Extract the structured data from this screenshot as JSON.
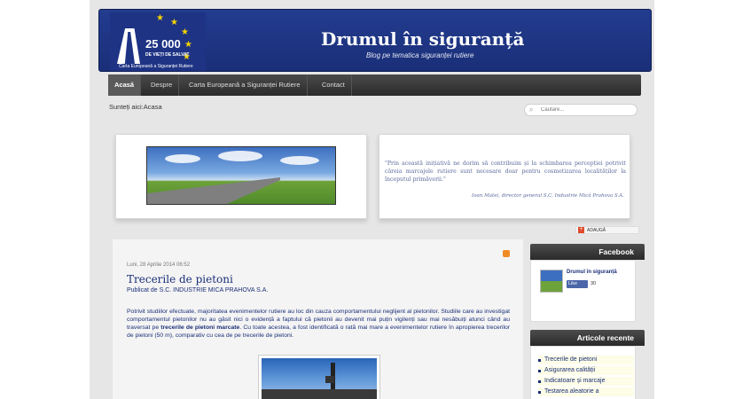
{
  "header": {
    "logo": {
      "number": "25 000",
      "line1": "DE VIEȚI DE SALVAT",
      "line2": "Carta Europeană a Siguranței Rutiere"
    },
    "title": "Drumul în siguranță",
    "tagline": "Blog pe tematica siguranței rutiere"
  },
  "nav": {
    "items": [
      "Acasă",
      "Despre",
      "Carta Europeană a Siguranței Rutiere",
      "Contact"
    ],
    "active_index": 0
  },
  "breadcrumb": "Sunteți aici:Acasa",
  "search": {
    "placeholder": "Căutare..."
  },
  "quote": {
    "text": "\"Prin această inițiativă ne dorim să contribuim și la schimbarea percepției potrivit căreia marcajele rutiere sunt necesare doar pentru cosmetizarea localităților la începutul primăverii.\"",
    "author": "Ioan Matei, director general S.C. Industrie Mică Prahova S.A."
  },
  "share": {
    "label": "ADAUGĂ"
  },
  "post": {
    "date": "Luni, 28 Aprilie 2014 06:52",
    "title": "Trecerile de pietoni",
    "byline": "Publicat de S.C. INDUSTRIE MICA PRAHOVA S.A.",
    "p1": "Potrivit studiilor efectuate, majoritatea evenimentelor rutiere au loc din cauza comportamentului neglijent al pietonilor. Studiile care au investigat comportamentul pietonilor nu au găsit nici o evidență a faptului că pietonii au devenit mai puțin vigilenți sau mai nesăbuiți atunci când au traversat pe",
    "p1_bold": "trecerile de pietoni marcate",
    "p1_end": ". Cu toate acestea, a fost identificată o rată mai mare a evenimentelor rutiere în apropierea trecerilor de pietoni (50 m), comparativ cu cea de pe trecerile de pietoni."
  },
  "sidebar": {
    "facebook": {
      "title": "Facebook",
      "page_name": "Drumul în siguranță",
      "like_label": "Like",
      "like_count": "30"
    },
    "recent": {
      "title": "Articole recente",
      "items": [
        "Trecerile de pietoni",
        "Asigurarea calității",
        "Indicatoare și marcaje",
        "Testarea aleatorie a"
      ]
    }
  },
  "colors": {
    "header_blue": "#1f358a",
    "link_blue": "#1a2f78",
    "nav_dark": "#2b2b2b"
  }
}
